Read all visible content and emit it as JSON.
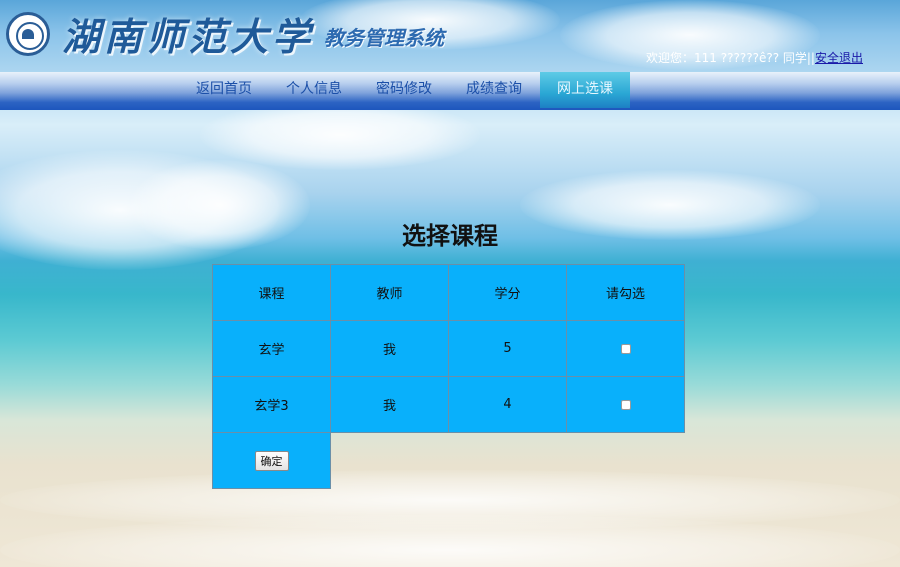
{
  "header": {
    "university_name": "湖南师范大学",
    "system_name": "教务管理系统",
    "welcome_prefix": "欢迎您：111 ??????ê?? 同学||",
    "logout_label": "安全退出"
  },
  "nav": {
    "items": [
      {
        "label": "返回首页",
        "active": false
      },
      {
        "label": "个人信息",
        "active": false
      },
      {
        "label": "密码修改",
        "active": false
      },
      {
        "label": "成绩查询",
        "active": false
      },
      {
        "label": "网上选课",
        "active": true
      }
    ]
  },
  "main": {
    "title": "选择课程",
    "table": {
      "headers": [
        "课程",
        "教师",
        "学分",
        "请勾选"
      ],
      "rows": [
        {
          "course": "玄学",
          "teacher": "我",
          "credit": "5",
          "checked": false
        },
        {
          "course": "玄学3",
          "teacher": "我",
          "credit": "4",
          "checked": false
        }
      ],
      "confirm_label": "确定"
    }
  },
  "colors": {
    "table_cell": "#09b0fb",
    "nav_active": "#2aa7d4",
    "nav_text": "#1b4fa8"
  }
}
